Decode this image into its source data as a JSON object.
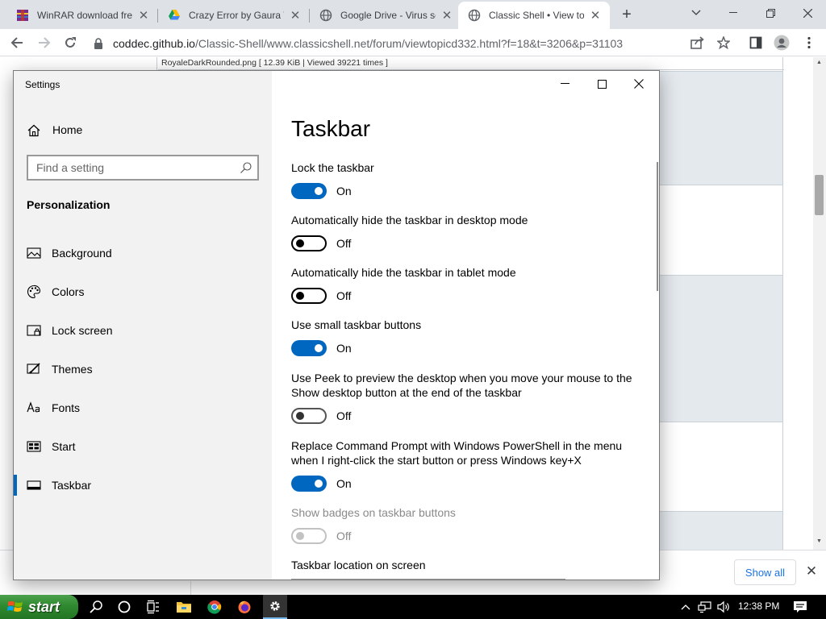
{
  "browser": {
    "tabs": [
      {
        "title": "WinRAR download free",
        "icon": "winrar-icon",
        "active": false
      },
      {
        "title": "Crazy Error by Gaura V",
        "icon": "google-drive-icon",
        "active": false
      },
      {
        "title": "Google Drive - Virus sc",
        "icon": "globe-icon",
        "active": false
      },
      {
        "title": "Classic Shell • View top",
        "icon": "globe-icon",
        "active": true
      }
    ],
    "url_host": "coddec.github.io",
    "url_path": "/Classic-Shell/www.classicshell.net/forum/viewtopicd332.html?f=18&t=3206&p=31103"
  },
  "page": {
    "image_caption": "RoyaleDarkRounded.png [ 12.39 KiB | Viewed 39221 times ]"
  },
  "downloads": {
    "show_all_label": "Show all"
  },
  "settings": {
    "app_title": "Settings",
    "home_label": "Home",
    "search_placeholder": "Find a setting",
    "section_label": "Personalization",
    "nav_items": [
      {
        "label": "Background",
        "icon": "background-icon"
      },
      {
        "label": "Colors",
        "icon": "palette-icon"
      },
      {
        "label": "Lock screen",
        "icon": "lock-screen-icon"
      },
      {
        "label": "Themes",
        "icon": "themes-icon"
      },
      {
        "label": "Fonts",
        "icon": "fonts-icon"
      },
      {
        "label": "Start",
        "icon": "start-icon"
      },
      {
        "label": "Taskbar",
        "icon": "taskbar-icon",
        "selected": true
      }
    ],
    "page_title": "Taskbar",
    "options": [
      {
        "label": "Lock the taskbar",
        "state": "On",
        "on": true
      },
      {
        "label": "Automatically hide the taskbar in desktop mode",
        "state": "Off",
        "on": false
      },
      {
        "label": "Automatically hide the taskbar in tablet mode",
        "state": "Off",
        "on": false
      },
      {
        "label": "Use small taskbar buttons",
        "state": "On",
        "on": true
      },
      {
        "label_line1": "Use Peek to preview the desktop when you move your mouse to the",
        "label_line2": "Show desktop button at the end of the taskbar",
        "state": "Off",
        "on": false
      },
      {
        "label_line1": "Replace Command Prompt with Windows PowerShell in the menu",
        "label_line2": "when I right-click the start button or press Windows key+X",
        "state": "On",
        "on": true
      },
      {
        "label": "Show badges on taskbar buttons",
        "state": "Off",
        "on": false,
        "disabled": true
      }
    ],
    "location_label": "Taskbar location on screen"
  },
  "taskbar": {
    "start_label": "start",
    "clock": "12:38 PM",
    "accent_color": "#0067c0",
    "start_color": "#2f8a2f"
  }
}
